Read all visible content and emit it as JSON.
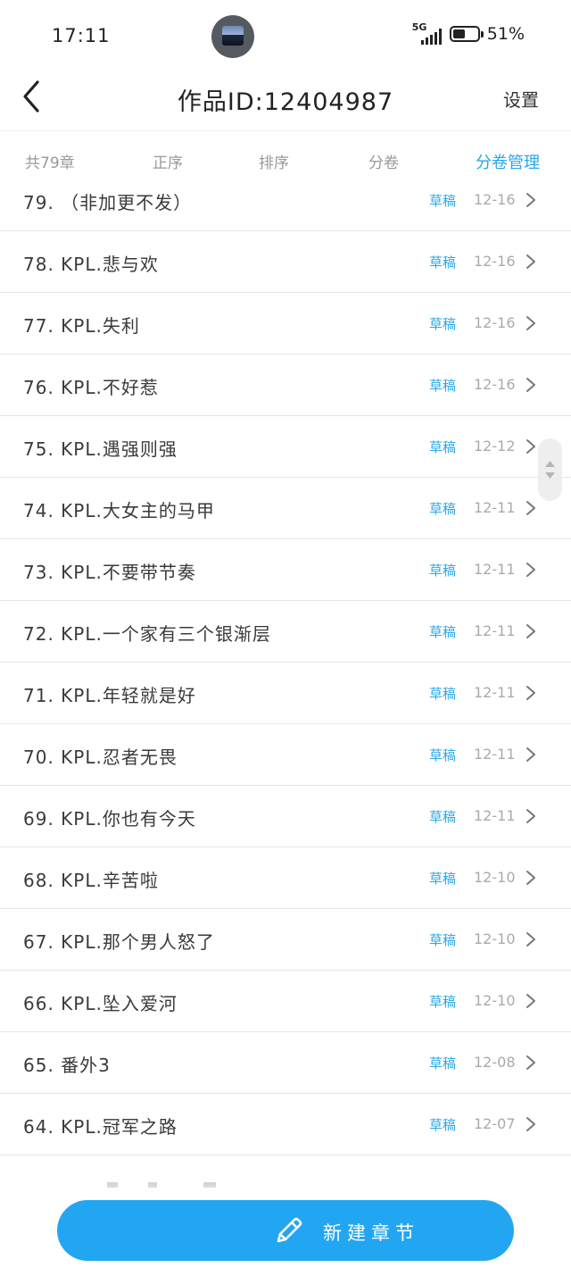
{
  "status_bar": {
    "time": "17:11",
    "network": "5G",
    "battery_pct": "51%",
    "battery_level": 0.51,
    "app_icon": "app-thumbnail-icon"
  },
  "nav": {
    "back_icon": "chevron-left-icon",
    "title": "作品ID:12404987",
    "settings_label": "设置"
  },
  "toolbar": {
    "count": "共79章",
    "order": "正序",
    "sort": "排序",
    "volume": "分卷",
    "manage": "分卷管理"
  },
  "chapters": [
    {
      "title": "79. （非加更不发）",
      "status": "草稿",
      "date": "12-16"
    },
    {
      "title": "78. KPL.悲与欢",
      "status": "草稿",
      "date": "12-16"
    },
    {
      "title": "77. KPL.失利",
      "status": "草稿",
      "date": "12-16"
    },
    {
      "title": "76. KPL.不好惹",
      "status": "草稿",
      "date": "12-16"
    },
    {
      "title": "75. KPL.遇强则强",
      "status": "草稿",
      "date": "12-12"
    },
    {
      "title": "74. KPL.大女主的马甲",
      "status": "草稿",
      "date": "12-11"
    },
    {
      "title": "73. KPL.不要带节奏",
      "status": "草稿",
      "date": "12-11"
    },
    {
      "title": "72. KPL.一个家有三个银渐层",
      "status": "草稿",
      "date": "12-11"
    },
    {
      "title": "71. KPL.年轻就是好",
      "status": "草稿",
      "date": "12-11"
    },
    {
      "title": "70. KPL.忍者无畏",
      "status": "草稿",
      "date": "12-11"
    },
    {
      "title": "69. KPL.你也有今天",
      "status": "草稿",
      "date": "12-11"
    },
    {
      "title": "68. KPL.辛苦啦",
      "status": "草稿",
      "date": "12-10"
    },
    {
      "title": "67. KPL.那个男人怒了",
      "status": "草稿",
      "date": "12-10"
    },
    {
      "title": "66. KPL.坠入爱河",
      "status": "草稿",
      "date": "12-10"
    },
    {
      "title": "65. 番外3",
      "status": "草稿",
      "date": "12-08"
    },
    {
      "title": "64. KPL.冠军之路",
      "status": "草稿",
      "date": "12-07"
    }
  ],
  "new_chapter": {
    "label": "新建章节",
    "icon": "pencil-icon"
  },
  "colors": {
    "accent": "#23a6f2",
    "draft_status": "#29a7e8",
    "muted_text": "#999999"
  }
}
